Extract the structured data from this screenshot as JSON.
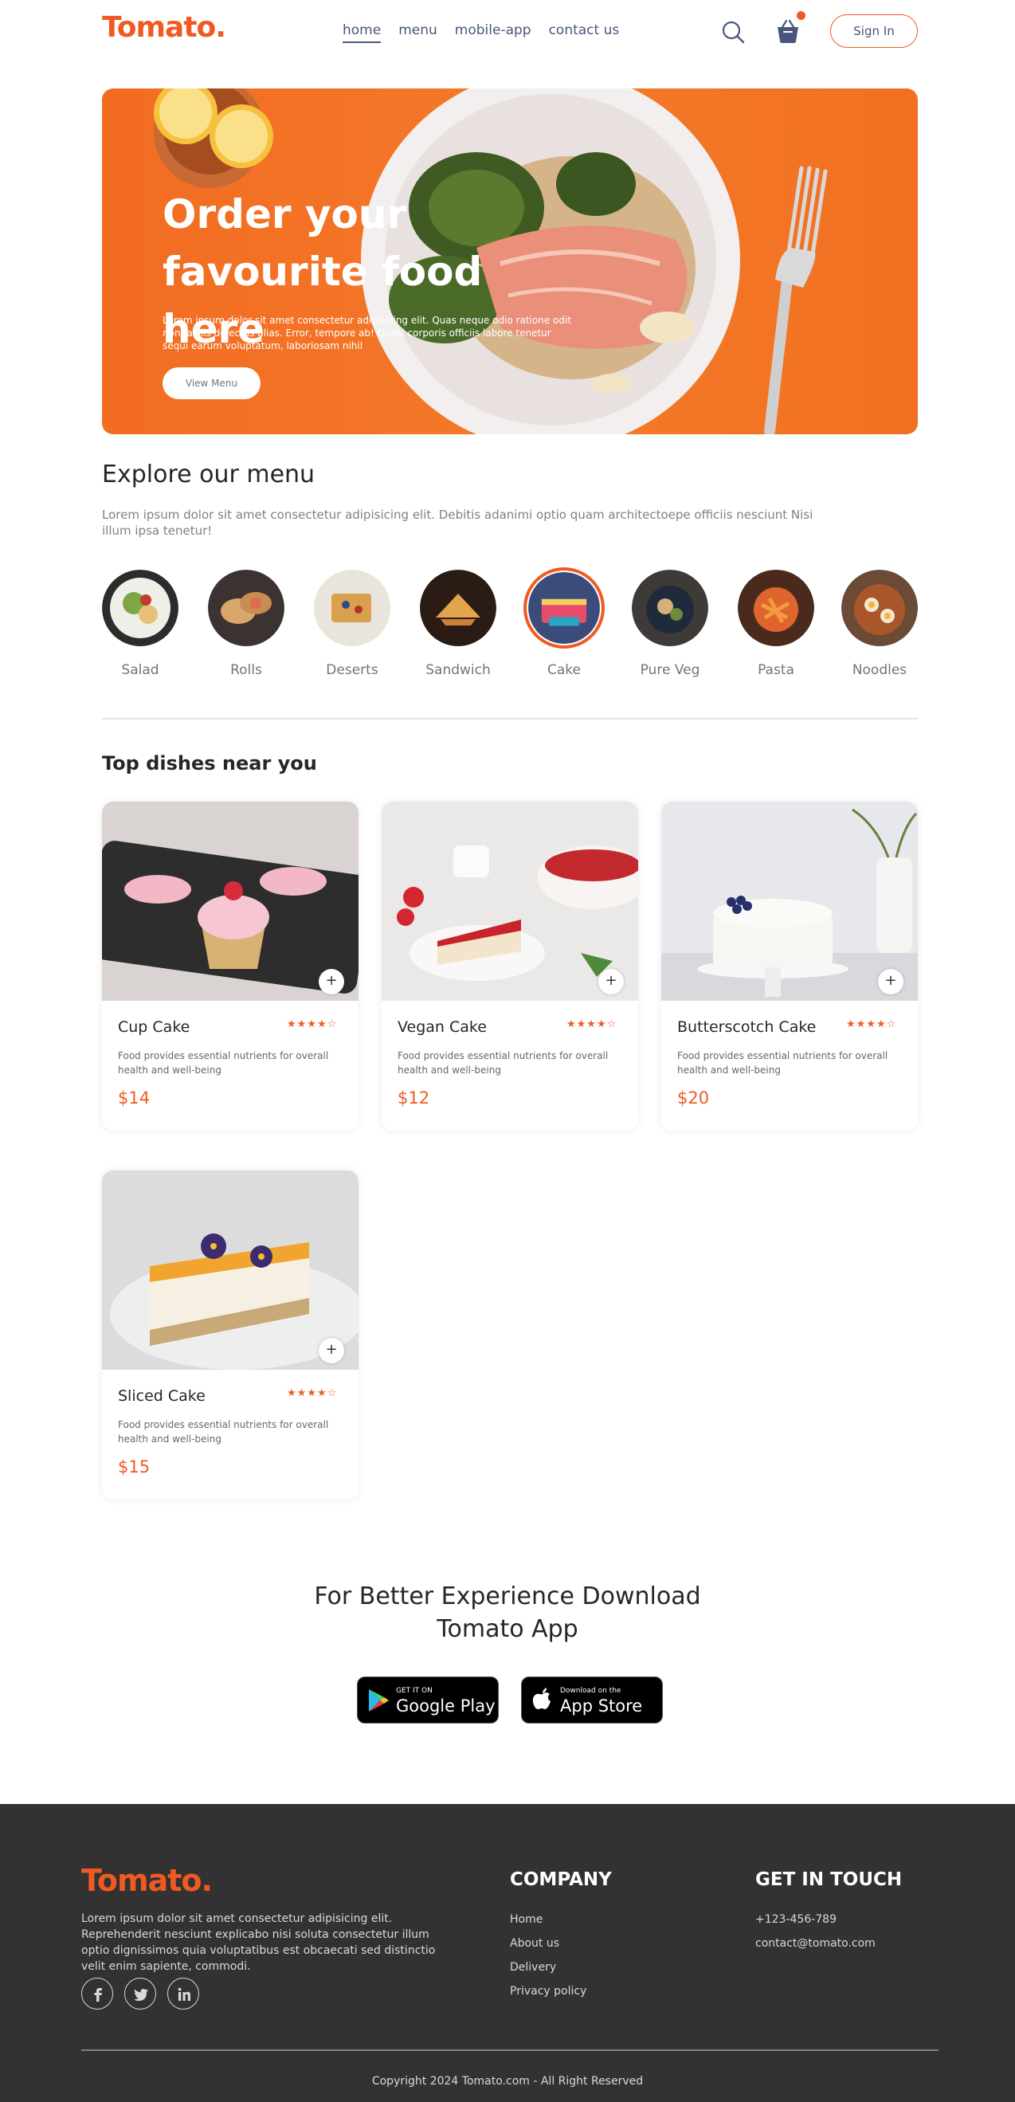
{
  "brand": {
    "logo": "Tomato.",
    "accent": "#f05a22"
  },
  "nav": {
    "links": [
      "home",
      "menu",
      "mobile-app",
      "contact us"
    ],
    "active": "home",
    "signin_label": "Sign In",
    "icons": [
      "search-icon",
      "basket-icon"
    ]
  },
  "hero": {
    "title": "Order your favourite food here",
    "text": "Lorem ipsum dolor sit amet consectetur adipisicing elit. Quas neque odio ratione odit non facilis delectus alias. Error, tempore ab! Quasi corporis officiis labore tenetur sequi earum voluptatum, laboriosam nihil",
    "button_label": "View Menu"
  },
  "explore": {
    "title": "Explore our menu",
    "text": "Lorem ipsum dolor sit amet consectetur adipisicing elit. Debitis adanimi optio quam architectoepe officiis nesciunt Nisi illum ipsa tenetur!",
    "items": [
      "Salad",
      "Rolls",
      "Deserts",
      "Sandwich",
      "Cake",
      "Pure Veg",
      "Pasta",
      "Noodles"
    ],
    "active": "Cake"
  },
  "dishes": {
    "title": "Top dishes near you",
    "items": [
      {
        "name": "Cup Cake",
        "desc": "Food provides essential nutrients for overall health and well-being",
        "price": "$14",
        "rating": 4
      },
      {
        "name": "Vegan Cake",
        "desc": "Food provides essential nutrients for overall health and well-being",
        "price": "$12",
        "rating": 4
      },
      {
        "name": "Butterscotch Cake",
        "desc": "Food provides essential nutrients for overall health and well-being",
        "price": "$20",
        "rating": 4
      },
      {
        "name": "Sliced Cake",
        "desc": "Food provides essential nutrients for overall health and well-being",
        "price": "$15",
        "rating": 4
      }
    ],
    "stars": "★★★★☆",
    "add_symbol": "+"
  },
  "app": {
    "title_line1": "For Better Experience Download",
    "title_line2": "Tomato App",
    "google": {
      "small": "GET IT ON",
      "big": "Google Play"
    },
    "apple": {
      "small": "Download on the",
      "big": "App Store"
    }
  },
  "footer": {
    "logo": "Tomato.",
    "text": "Lorem ipsum dolor sit amet consectetur adipisicing elit. Reprehenderit nesciunt explicabo nisi soluta consectetur illum optio dignissimos quia voluptatibus est obcaecati sed distinctio velit enim sapiente, commodi.",
    "social": [
      "facebook-icon",
      "twitter-icon",
      "linkedin-icon"
    ],
    "company_title": "COMPANY",
    "company_links": [
      "Home",
      "About us",
      "Delivery",
      "Privacy policy"
    ],
    "contact_title": "GET IN TOUCH",
    "contact": [
      "+123-456-789",
      "contact@tomato.com"
    ],
    "copyright": "Copyright 2024 Tomato.com - All Right Reserved"
  }
}
